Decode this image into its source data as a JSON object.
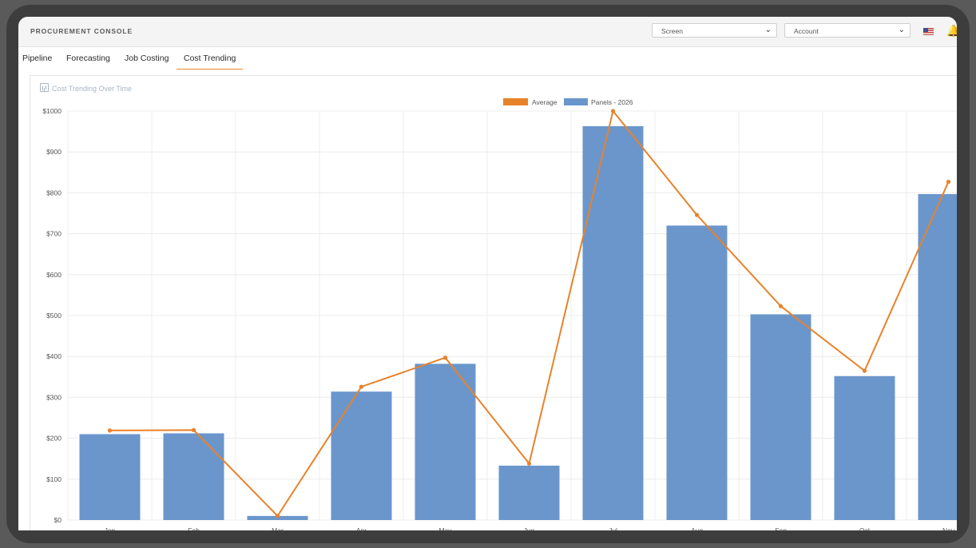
{
  "header": {
    "app_title": "PROCUREMENT CONSOLE",
    "screen_select": "Screen",
    "account_select": "Account",
    "flag_icon": "us-flag-icon",
    "bell_icon": "bell-icon"
  },
  "tabs": [
    {
      "label": "Pipeline",
      "active": false
    },
    {
      "label": "Forecasting",
      "active": false
    },
    {
      "label": "Job Costing",
      "active": false
    },
    {
      "label": "Cost Trending",
      "active": true
    }
  ],
  "card": {
    "title": "Cost Trending Over Time"
  },
  "chart_data": {
    "type": "bar",
    "categories": [
      "Jan",
      "Feb",
      "Mar",
      "Apr",
      "May",
      "Jun",
      "Jul",
      "Aug",
      "Sep",
      "Oct",
      "Nov"
    ],
    "series": [
      {
        "name": "Panels - 2026",
        "type": "bar",
        "color": "#6a96cc",
        "values": [
          210,
          212,
          10,
          314,
          382,
          133,
          963,
          720,
          503,
          352,
          797
        ]
      },
      {
        "name": "Average",
        "type": "line",
        "color": "#e8822a",
        "values": [
          219,
          220,
          10,
          326,
          397,
          138,
          1000,
          746,
          523,
          365,
          827
        ]
      }
    ],
    "yticks": [
      "$0",
      "$100",
      "$200",
      "$300",
      "$400",
      "$500",
      "$600",
      "$700",
      "$800",
      "$900",
      "$1000"
    ],
    "ylim": [
      0,
      1000
    ],
    "grid": true,
    "legend_position": "top-center"
  }
}
